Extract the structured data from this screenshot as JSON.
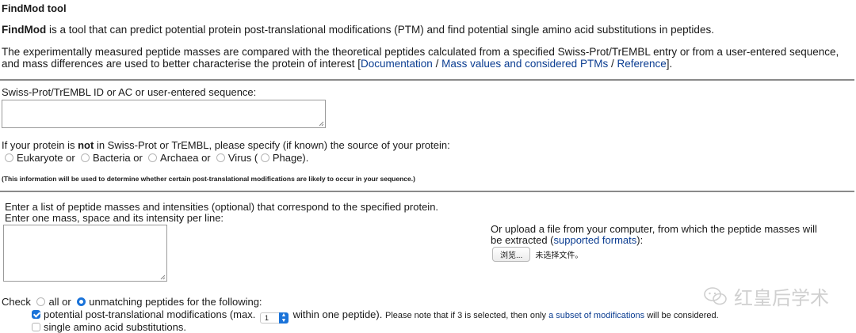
{
  "tool": {
    "title": "FindMod tool",
    "intro_bold": "FindMod",
    "intro_rest": " is a tool that can predict potential protein post-translational modifications (PTM) and find potential single amino acid substitutions in peptides.",
    "desc": "The experimentally measured peptide masses are compared with the theoretical peptides calculated from a specified Swiss-Prot/TrEMBL entry or from a user-entered sequence, and mass differences are used to better characterise the protein of interest [",
    "links": {
      "documentation": "Documentation",
      "mass_values": "Mass values and considered PTMs",
      "reference": "Reference",
      "sep": " / ",
      "end": "]."
    }
  },
  "sequence": {
    "label": "Swiss-Prot/TrEMBL ID or AC or user-entered sequence:",
    "value": ""
  },
  "source": {
    "label_pre": "If your protein is ",
    "label_bold": "not",
    "label_post": " in Swiss-Prot or TrEMBL, please specify (if known) the source of your protein:",
    "options": [
      "Eukaryote or",
      "Bacteria or",
      "Archaea or",
      "Virus (",
      "Phage)."
    ],
    "note": "(This information will be used to determine whether certain post-translational modifications are likely to occur in your sequence.)"
  },
  "masses": {
    "label1": "Enter a list of peptide masses and intensities (optional) that correspond to the specified protein.",
    "label2": "Enter one mass, space and its intensity per line:",
    "value": ""
  },
  "upload": {
    "label1": "Or upload a file from your computer, from which the peptide masses will",
    "label2_pre": "be extracted (",
    "label2_link": "supported formats",
    "label2_post": "):",
    "browse_label": "浏览...",
    "no_file": "未选择文件。"
  },
  "check": {
    "label": "Check",
    "all": "all or",
    "unmatching": "unmatching peptides for the following:",
    "selected": "unmatching",
    "ptm_label": "potential post-translational modifications (max.",
    "ptm_max": "1",
    "ptm_post": "within one peptide).",
    "ptm_note_pre": "Please note that if 3 is selected, then only ",
    "ptm_note_link": "a subset of modifications",
    "ptm_note_post": " will be considered.",
    "ptm_checked": true,
    "subst_label": "single amino acid substitutions.",
    "subst_checked": false
  },
  "watermark": {
    "text": "红皇后学术",
    "icon": "wechat-icon"
  }
}
